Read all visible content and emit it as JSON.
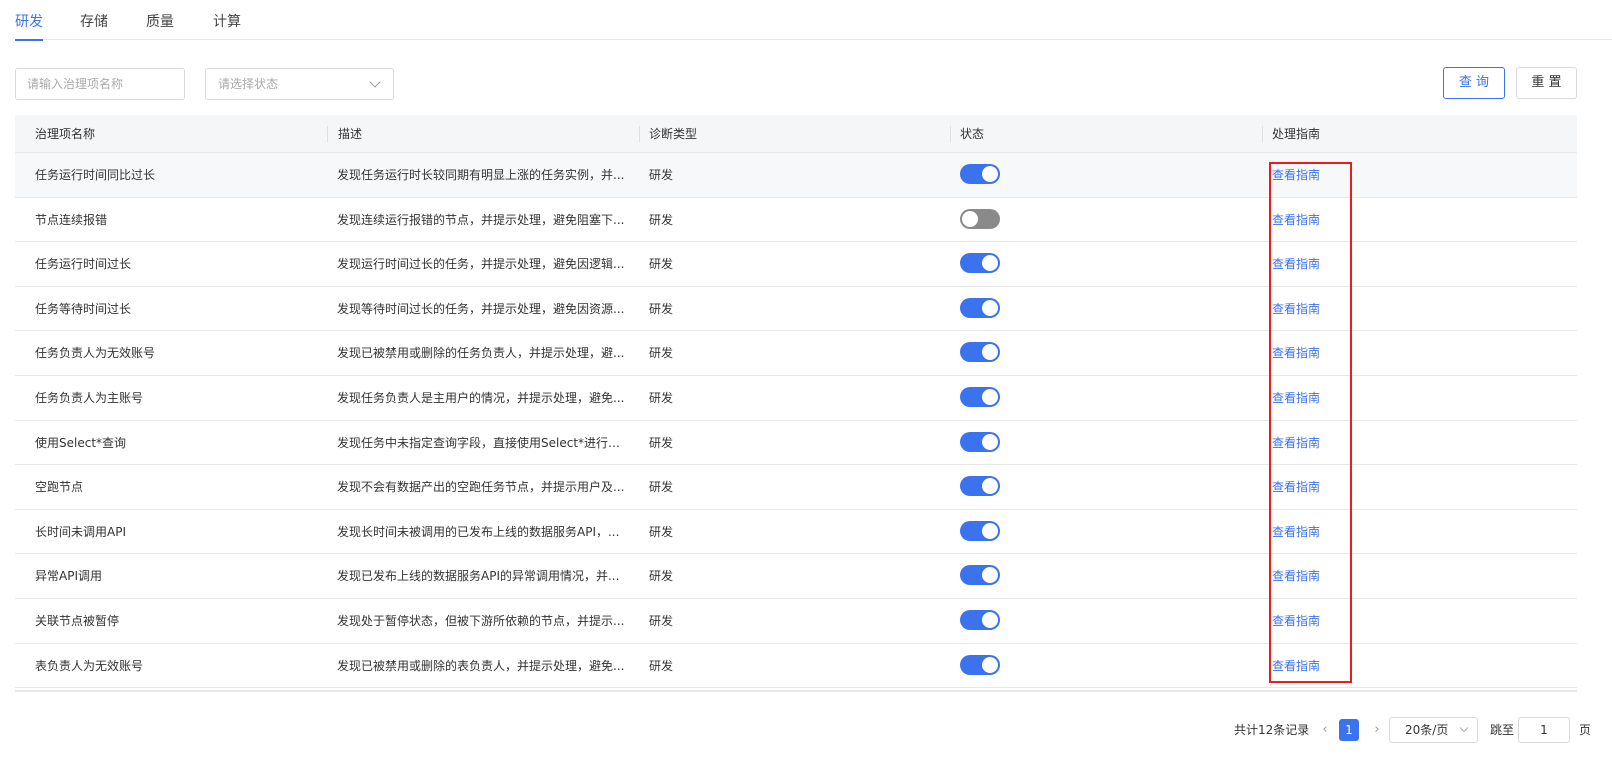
{
  "tabs": [
    {
      "label": "研发",
      "active": true
    },
    {
      "label": "存储",
      "active": false
    },
    {
      "label": "质量",
      "active": false
    },
    {
      "label": "计算",
      "active": false
    }
  ],
  "filters": {
    "name_placeholder": "请输入治理项名称",
    "status_placeholder": "请选择状态"
  },
  "buttons": {
    "query": "查 询",
    "reset": "重 置"
  },
  "table": {
    "headers": [
      "治理项名称",
      "描述",
      "诊断类型",
      "状态",
      "处理指南"
    ],
    "rows": [
      {
        "name": "任务运行时间同比过长",
        "desc": "发现任务运行时长较同期有明显上涨的任务实例，并...",
        "type": "研发",
        "enabled": true,
        "guide": "查看指南"
      },
      {
        "name": "节点连续报错",
        "desc": "发现连续运行报错的节点，并提示处理，避免阻塞下...",
        "type": "研发",
        "enabled": false,
        "guide": "查看指南"
      },
      {
        "name": "任务运行时间过长",
        "desc": "发现运行时间过长的任务，并提示处理，避免因逻辑...",
        "type": "研发",
        "enabled": true,
        "guide": "查看指南"
      },
      {
        "name": "任务等待时间过长",
        "desc": "发现等待时间过长的任务，并提示处理，避免因资源...",
        "type": "研发",
        "enabled": true,
        "guide": "查看指南"
      },
      {
        "name": "任务负责人为无效账号",
        "desc": "发现已被禁用或删除的任务负责人，并提示处理，避...",
        "type": "研发",
        "enabled": true,
        "guide": "查看指南"
      },
      {
        "name": "任务负责人为主账号",
        "desc": "发现任务负责人是主用户的情况，并提示处理，避免...",
        "type": "研发",
        "enabled": true,
        "guide": "查看指南"
      },
      {
        "name": "使用Select*查询",
        "desc": "发现任务中未指定查询字段，直接使用Select*进行查...",
        "type": "研发",
        "enabled": true,
        "guide": "查看指南"
      },
      {
        "name": "空跑节点",
        "desc": "发现不会有数据产出的空跑任务节点，并提示用户及...",
        "type": "研发",
        "enabled": true,
        "guide": "查看指南"
      },
      {
        "name": "长时间未调用API",
        "desc": "发现长时间未被调用的已发布上线的数据服务API，...",
        "type": "研发",
        "enabled": true,
        "guide": "查看指南"
      },
      {
        "name": "异常API调用",
        "desc": "发现已发布上线的数据服务API的异常调用情况，并...",
        "type": "研发",
        "enabled": true,
        "guide": "查看指南"
      },
      {
        "name": "关联节点被暂停",
        "desc": "发现处于暂停状态，但被下游所依赖的节点，并提示...",
        "type": "研发",
        "enabled": true,
        "guide": "查看指南"
      },
      {
        "name": "表负责人为无效账号",
        "desc": "发现已被禁用或删除的表负责人，并提示处理，避免...",
        "type": "研发",
        "enabled": true,
        "guide": "查看指南"
      }
    ]
  },
  "pagination": {
    "total_text": "共计12条记录",
    "current_page": "1",
    "page_size": "20条/页",
    "jump_label": "跳至",
    "jump_value": "1",
    "page_unit": "页"
  },
  "colors": {
    "accent": "#3b72ee",
    "highlight": "#e61e1e"
  },
  "icons": {
    "prev": "chevron-left-icon",
    "next": "chevron-right-icon",
    "select": "chevron-down-icon"
  }
}
